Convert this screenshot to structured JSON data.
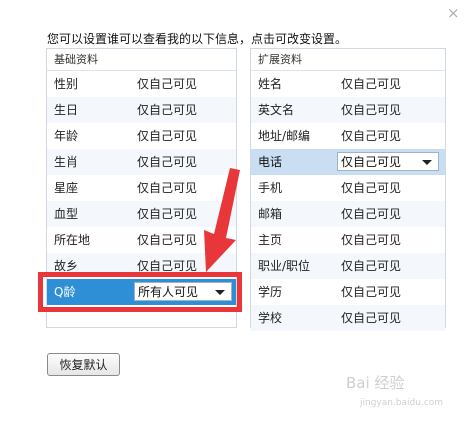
{
  "dialog": {
    "close_glyph": "×",
    "intro": "您可以设置谁可以查看我的以下信息，点击可改变设置。"
  },
  "basic": {
    "header": "基础资料",
    "rows": [
      {
        "label": "性别",
        "value": "仅自己可见"
      },
      {
        "label": "生日",
        "value": "仅自己可见"
      },
      {
        "label": "年龄",
        "value": "仅自己可见"
      },
      {
        "label": "生肖",
        "value": "仅自己可见"
      },
      {
        "label": "星座",
        "value": "仅自己可见"
      },
      {
        "label": "血型",
        "value": "仅自己可见"
      },
      {
        "label": "所在地",
        "value": "仅自己可见"
      },
      {
        "label": "故乡",
        "value": "仅自己可见"
      }
    ],
    "q_age": {
      "label": "Q龄",
      "value": "所有人可见"
    }
  },
  "extended": {
    "header": "扩展资料",
    "rows": [
      {
        "label": "姓名",
        "value": "仅自己可见"
      },
      {
        "label": "英文名",
        "value": "仅自己可见"
      },
      {
        "label": "地址/邮编",
        "value": "仅自己可见"
      },
      {
        "label": "电话",
        "value": "仅自己可见"
      },
      {
        "label": "手机",
        "value": "仅自己可见"
      },
      {
        "label": "邮箱",
        "value": "仅自己可见"
      },
      {
        "label": "主页",
        "value": "仅自己可见"
      },
      {
        "label": "职业/职位",
        "value": "仅自己可见"
      },
      {
        "label": "学历",
        "value": "仅自己可见"
      },
      {
        "label": "学校",
        "value": "仅自己可见"
      }
    ]
  },
  "reset_button": "恢复默认",
  "watermark": {
    "main": "Bai 经验",
    "sub": "jingyan.baidu.com"
  },
  "colors": {
    "highlight": "#2e8fd6",
    "selected": "#c9def2",
    "annotation": "#e8363a"
  },
  "icons": {
    "close": "close-icon",
    "dropdown": "chevron-down-icon",
    "annotation": "red-arrow-icon"
  }
}
